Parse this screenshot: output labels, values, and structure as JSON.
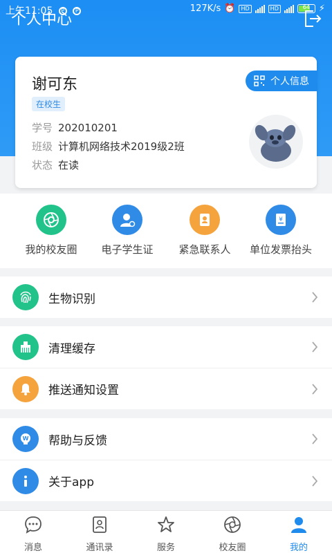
{
  "status_bar": {
    "time": "上午11:05",
    "net_speed": "127K/s",
    "battery": "64"
  },
  "header": {
    "title": "个人中心"
  },
  "profile": {
    "name": "谢可东",
    "badge": "在校生",
    "info_button": "个人信息",
    "student_id_label": "学号",
    "student_id": "202010201",
    "class_label": "班级",
    "class": "计算机网络技术2019级2班",
    "status_label": "状态",
    "status": "在读"
  },
  "quick_actions": [
    {
      "label": "我的校友圈",
      "icon": "aperture-icon",
      "color": "#21c38a"
    },
    {
      "label": "电子学生证",
      "icon": "student-card-icon",
      "color": "#2f8be6"
    },
    {
      "label": "紧急联系人",
      "icon": "contact-book-icon",
      "color": "#f5a33c"
    },
    {
      "label": "单位发票抬头",
      "icon": "invoice-icon",
      "color": "#2f8be6"
    }
  ],
  "menu": {
    "biometrics": "生物识别",
    "clear_cache": "清理缓存",
    "push_settings": "推送通知设置",
    "help": "帮助与反馈",
    "about": "关于app"
  },
  "colors": {
    "primary": "#1f8bed",
    "green": "#21c38a",
    "orange": "#f5a33c"
  },
  "tabbar": {
    "messages": "消息",
    "contacts": "通讯录",
    "services": "服务",
    "alumni": "校友圈",
    "mine": "我的"
  }
}
